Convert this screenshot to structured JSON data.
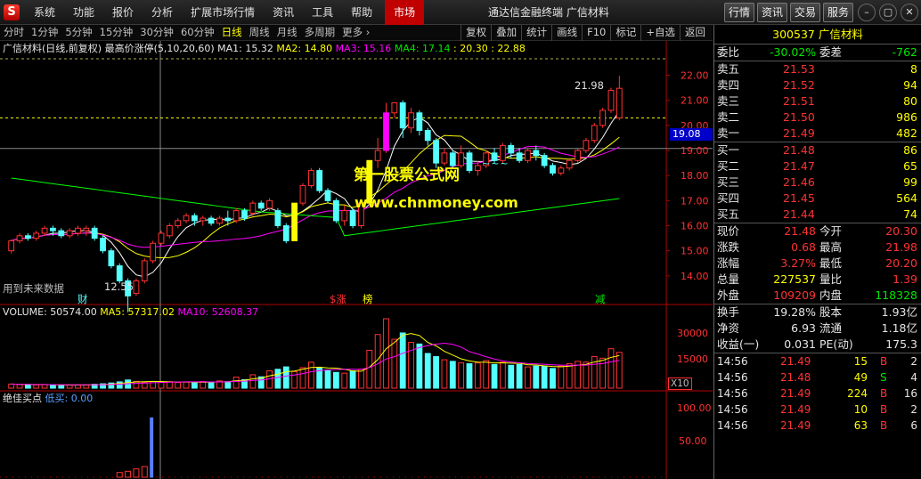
{
  "menubar": {
    "logo": "S",
    "items": [
      "系统",
      "功能",
      "报价",
      "分析",
      "扩展市场行情",
      "资讯",
      "工具",
      "帮助"
    ],
    "market": "市场",
    "title": "通达信金融终端  广信材料",
    "right_buttons": [
      "行情",
      "资讯",
      "交易",
      "服务"
    ],
    "window_controls": [
      "–",
      "▢",
      "✕"
    ]
  },
  "toolbar": {
    "periods": [
      "分时",
      "1分钟",
      "5分钟",
      "15分钟",
      "30分钟",
      "60分钟",
      "日线",
      "周线",
      "月线",
      "多周期",
      "更多 ›"
    ],
    "active_period": "日线",
    "tools": [
      "复权",
      "叠加",
      "统计",
      "画线",
      "F10",
      "标记",
      "+自选",
      "返回"
    ]
  },
  "chart_info": {
    "stock": "广信材料(日线,前复权)",
    "indicator": "最高价涨停(5,10,20,60)",
    "ma1": "MA1: 15.32",
    "ma2": "MA2: 14.80",
    "ma3": "MA3: 15.16",
    "ma4": "MA4: 17.14",
    "extra": ": 20.30  : 22.88",
    "watermark1": "第一股票公式网",
    "watermark2": "www.chnmoney.com",
    "future_note": "用到未来数据",
    "low_label": "12.55",
    "high_label": "21.98",
    "cur_price_tag": "19.08",
    "marker_cai": "财",
    "marker_zhang": "$涨",
    "marker_bang": "榜",
    "marker_jian": "减",
    "tilde_marks": "~~~",
    "price_axis": [
      "22.00",
      "21.00",
      "20.00",
      "19.00",
      "18.00",
      "17.00",
      "16.00",
      "15.00",
      "14.00"
    ],
    "colors": {
      "ma1": "#ffffff",
      "ma2": "#ffff00",
      "ma3": "#ff00ff",
      "ma4": "#00ff00",
      "up": "#ff3232",
      "down": "#54ffff",
      "bg": "#000000"
    }
  },
  "volume_info": {
    "volume": "VOLUME: 50574.00",
    "ma5": "MA5: 57317.02",
    "ma10": "MA10: 52608.37",
    "axis": [
      "30000",
      "15000"
    ],
    "unit": "X10"
  },
  "buy_info": {
    "title": "绝佳买点",
    "low_buy": "低买: 0.00",
    "axis": [
      "100.00",
      "50.00"
    ]
  },
  "quote": {
    "code": "300537",
    "name": "广信材料",
    "wb_label": "委比",
    "wb_value": "-30.02%",
    "wc_label": "委差",
    "wc_value": "-762",
    "asks": [
      {
        "label": "卖五",
        "price": "21.53",
        "vol": "8"
      },
      {
        "label": "卖四",
        "price": "21.52",
        "vol": "94"
      },
      {
        "label": "卖三",
        "price": "21.51",
        "vol": "80"
      },
      {
        "label": "卖二",
        "price": "21.50",
        "vol": "986"
      },
      {
        "label": "卖一",
        "price": "21.49",
        "vol": "482"
      }
    ],
    "bids": [
      {
        "label": "买一",
        "price": "21.48",
        "vol": "86"
      },
      {
        "label": "买二",
        "price": "21.47",
        "vol": "65"
      },
      {
        "label": "买三",
        "price": "21.46",
        "vol": "99"
      },
      {
        "label": "买四",
        "price": "21.45",
        "vol": "564"
      },
      {
        "label": "买五",
        "price": "21.44",
        "vol": "74"
      }
    ],
    "stats1": [
      {
        "l1": "现价",
        "v1": "21.48",
        "c1": "red",
        "l2": "今开",
        "v2": "20.30",
        "c2": "red"
      },
      {
        "l1": "涨跌",
        "v1": "0.68",
        "c1": "red",
        "l2": "最高",
        "v2": "21.98",
        "c2": "red"
      },
      {
        "l1": "涨幅",
        "v1": "3.27%",
        "c1": "red",
        "l2": "最低",
        "v2": "20.20",
        "c2": "red"
      },
      {
        "l1": "总量",
        "v1": "227537",
        "c1": "yellow",
        "l2": "量比",
        "v2": "1.39",
        "c2": "red"
      },
      {
        "l1": "外盘",
        "v1": "109209",
        "c1": "red",
        "l2": "内盘",
        "v2": "118328",
        "c2": "green"
      }
    ],
    "stats2": [
      {
        "l1": "换手",
        "v1": "19.28%",
        "c1": "wht",
        "l2": "股本",
        "v2": "1.93亿",
        "c2": "wht"
      },
      {
        "l1": "净资",
        "v1": "6.93",
        "c1": "wht",
        "l2": "流通",
        "v2": "1.18亿",
        "c2": "wht"
      },
      {
        "l1": "收益(一)",
        "v1": "0.031",
        "c1": "wht",
        "l2": "PE(动)",
        "v2": "175.3",
        "c2": "wht"
      }
    ],
    "ticks": [
      {
        "time": "14:56",
        "price": "21.49",
        "vol": "15",
        "bs": "B",
        "bsc": "red",
        "n": "2"
      },
      {
        "time": "14:56",
        "price": "21.48",
        "vol": "49",
        "bs": "S",
        "bsc": "green",
        "n": "4"
      },
      {
        "time": "14:56",
        "price": "21.49",
        "vol": "224",
        "bs": "B",
        "bsc": "red",
        "n": "16"
      },
      {
        "time": "14:56",
        "price": "21.49",
        "vol": "10",
        "bs": "B",
        "bsc": "red",
        "n": "2"
      },
      {
        "time": "14:56",
        "price": "21.49",
        "vol": "63",
        "bs": "B",
        "bsc": "red",
        "n": "6"
      }
    ]
  },
  "chart_data": {
    "type": "candlestick",
    "price_range": [
      13.0,
      22.8
    ],
    "candles": [
      [
        15.0,
        15.4,
        14.9,
        15.45
      ],
      [
        15.4,
        15.6,
        15.3,
        15.7
      ],
      [
        15.6,
        15.5,
        15.4,
        15.7
      ],
      [
        15.5,
        15.7,
        15.4,
        15.8
      ],
      [
        15.7,
        15.9,
        15.6,
        16.0
      ],
      [
        15.9,
        15.8,
        15.6,
        16.0
      ],
      [
        15.8,
        15.6,
        15.5,
        15.9
      ],
      [
        15.6,
        15.8,
        15.5,
        15.9
      ],
      [
        15.7,
        15.9,
        15.6,
        16.0
      ],
      [
        15.8,
        15.9,
        15.6,
        16.0
      ],
      [
        15.9,
        15.5,
        15.4,
        16.0
      ],
      [
        15.5,
        15.0,
        14.9,
        15.6
      ],
      [
        15.0,
        14.4,
        14.3,
        15.1
      ],
      [
        14.4,
        13.8,
        13.7,
        14.5
      ],
      [
        13.8,
        13.2,
        12.55,
        13.9
      ],
      [
        13.3,
        13.8,
        13.2,
        13.9
      ],
      [
        13.8,
        14.6,
        13.7,
        14.7
      ],
      [
        14.6,
        15.3,
        14.5,
        15.4
      ],
      [
        15.3,
        15.7,
        15.2,
        15.8
      ],
      [
        15.6,
        16.0,
        15.5,
        16.1
      ],
      [
        16.0,
        16.2,
        15.9,
        16.3
      ],
      [
        16.2,
        16.4,
        16.1,
        16.5
      ],
      [
        16.4,
        16.2,
        16.0,
        16.5
      ],
      [
        16.2,
        16.3,
        16.0,
        16.4
      ],
      [
        16.3,
        16.1,
        16.0,
        16.4
      ],
      [
        16.1,
        16.3,
        16.0,
        16.4
      ],
      [
        16.3,
        16.2,
        16.0,
        16.6
      ],
      [
        16.2,
        16.6,
        16.1,
        16.7
      ],
      [
        16.6,
        16.3,
        16.2,
        16.7
      ],
      [
        16.5,
        16.9,
        16.4,
        17.0
      ],
      [
        16.9,
        16.7,
        16.6,
        17.0
      ],
      [
        16.7,
        17.0,
        16.6,
        17.1
      ],
      [
        16.6,
        16.0,
        15.9,
        16.7
      ],
      [
        16.0,
        15.4,
        15.3,
        16.1
      ],
      [
        15.4,
        16.9,
        15.4,
        16.9
      ],
      [
        16.9,
        17.6,
        16.8,
        17.7
      ],
      [
        17.6,
        18.2,
        17.5,
        18.3
      ],
      [
        18.2,
        17.4,
        17.3,
        18.3
      ],
      [
        17.4,
        17.0,
        16.9,
        17.5
      ],
      [
        17.0,
        16.2,
        16.1,
        17.1
      ],
      [
        16.2,
        16.6,
        16.0,
        16.8
      ],
      [
        16.6,
        16.0,
        15.9,
        16.7
      ],
      [
        16.0,
        16.9,
        15.9,
        17.0
      ],
      [
        16.9,
        18.6,
        16.8,
        18.6
      ],
      [
        18.6,
        19.0,
        18.3,
        19.5
      ],
      [
        19.0,
        20.5,
        18.9,
        20.9
      ],
      [
        20.5,
        20.9,
        20.3,
        20.9
      ],
      [
        20.9,
        19.9,
        19.5,
        21.0
      ],
      [
        19.9,
        20.5,
        19.7,
        20.7
      ],
      [
        20.5,
        19.8,
        19.6,
        20.6
      ],
      [
        19.8,
        19.4,
        19.2,
        19.9
      ],
      [
        19.4,
        18.5,
        18.3,
        19.5
      ],
      [
        18.5,
        18.9,
        18.4,
        19.1
      ],
      [
        18.9,
        18.4,
        18.3,
        19.0
      ],
      [
        18.4,
        18.9,
        18.3,
        19.2
      ],
      [
        18.9,
        18.2,
        18.1,
        19.0
      ],
      [
        18.2,
        18.4,
        18.0,
        18.6
      ],
      [
        18.4,
        18.9,
        18.3,
        19.0
      ],
      [
        18.9,
        18.6,
        18.5,
        19.1
      ],
      [
        18.6,
        19.2,
        18.5,
        19.3
      ],
      [
        19.2,
        18.9,
        18.7,
        19.3
      ],
      [
        18.9,
        18.6,
        18.5,
        19.1
      ],
      [
        18.6,
        19.0,
        18.5,
        19.1
      ],
      [
        19.0,
        18.8,
        18.6,
        19.2
      ],
      [
        18.8,
        18.4,
        18.3,
        18.9
      ],
      [
        18.4,
        18.1,
        18.0,
        18.5
      ],
      [
        18.1,
        18.3,
        18.0,
        18.4
      ],
      [
        18.3,
        18.6,
        18.2,
        18.7
      ],
      [
        18.6,
        19.0,
        18.5,
        19.1
      ],
      [
        19.0,
        19.4,
        18.9,
        19.5
      ],
      [
        19.4,
        20.0,
        19.3,
        20.1
      ],
      [
        20.0,
        20.6,
        19.9,
        20.7
      ],
      [
        20.6,
        21.4,
        20.5,
        21.5
      ],
      [
        20.3,
        21.48,
        20.2,
        21.98
      ]
    ],
    "volume_range": [
      0,
      44000
    ],
    "volumes": [
      2600,
      2400,
      2200,
      2100,
      2300,
      2000,
      1900,
      2000,
      2100,
      2200,
      2500,
      2800,
      3300,
      4000,
      5200,
      4300,
      3700,
      4200,
      3900,
      4100,
      3600,
      4000,
      3500,
      4200,
      3800,
      4600,
      4100,
      7000,
      5400,
      8500,
      7200,
      11000,
      12000,
      13500,
      10500,
      13000,
      16500,
      13000,
      11000,
      10000,
      9500,
      11000,
      12000,
      24000,
      34000,
      44000,
      31000,
      35000,
      29000,
      28000,
      22000,
      20000,
      18000,
      17000,
      16000,
      15500,
      16000,
      17500,
      15000,
      16500,
      14500,
      15000,
      13500,
      14000,
      13800,
      12500,
      14000,
      15500,
      17000,
      16500,
      20000,
      19000,
      25000,
      22700
    ],
    "buy_range": [
      0,
      120
    ],
    "buy_points": [
      {
        "index": 30,
        "value": 8
      },
      {
        "index": 31,
        "value": 10
      },
      {
        "index": 32,
        "value": 14
      },
      {
        "index": 33,
        "value": 18
      },
      {
        "index": 34,
        "value": 100
      }
    ]
  }
}
